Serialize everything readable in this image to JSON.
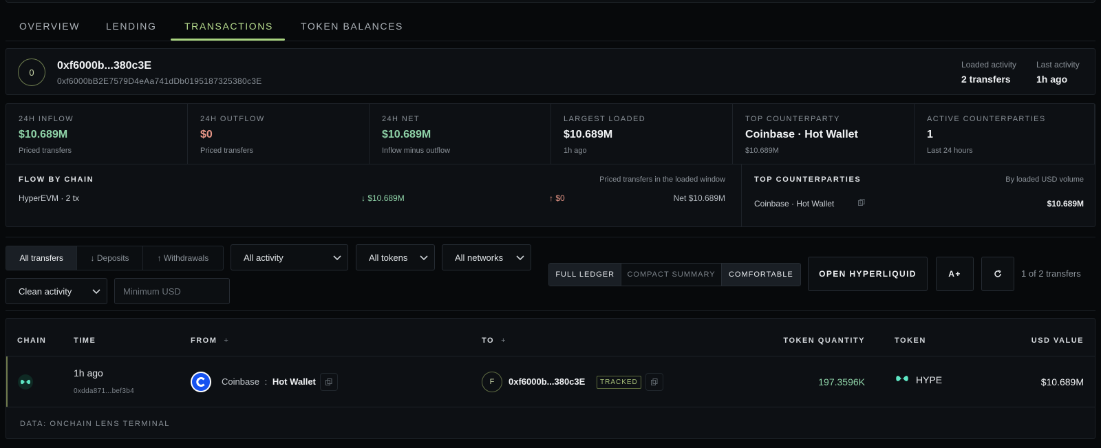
{
  "tabs": [
    {
      "label": "OVERVIEW"
    },
    {
      "label": "LENDING"
    },
    {
      "label": "TRANSACTIONS"
    },
    {
      "label": "TOKEN BALANCES"
    }
  ],
  "wallet": {
    "avatar_letter": "0",
    "short": "0xf6000b...380c3E",
    "full": "0xf6000bB2E7579D4eAa741dDb0195187325380c3E",
    "loaded_activity_label": "Loaded activity",
    "loaded_activity_value": "2 transfers",
    "last_activity_label": "Last activity",
    "last_activity_value": "1h ago"
  },
  "stats": [
    {
      "label": "24H INFLOW",
      "value": "$10.689M",
      "sub": "Priced transfers"
    },
    {
      "label": "24H OUTFLOW",
      "value": "$0",
      "sub": "Priced transfers"
    },
    {
      "label": "24H NET",
      "value": "$10.689M",
      "sub": "Inflow minus outflow"
    },
    {
      "label": "LARGEST LOADED",
      "value": "$10.689M",
      "sub": "1h ago"
    },
    {
      "label": "TOP COUNTERPARTY",
      "value": "Coinbase · Hot Wallet",
      "sub": "$10.689M"
    },
    {
      "label": "ACTIVE COUNTERPARTIES",
      "value": "1",
      "sub": "Last 24 hours"
    }
  ],
  "flow": {
    "title": "FLOW BY CHAIN",
    "note": "Priced transfers in the loaded window",
    "chain": "HyperEVM · 2 tx",
    "inflow": "↓ $10.689M",
    "outflow": "↑ $0",
    "net": "Net $10.689M"
  },
  "counterparties": {
    "title": "TOP COUNTERPARTIES",
    "note": "By loaded USD volume",
    "name": "Coinbase · Hot Wallet",
    "value": "$10.689M"
  },
  "filters": {
    "segments": [
      "All transfers",
      "↓ Deposits",
      "↑ Withdrawals"
    ],
    "activity": "All activity",
    "tokens": "All tokens",
    "networks": "All networks",
    "clean": "Clean activity",
    "min_usd_placeholder": "Minimum USD"
  },
  "view": {
    "options": [
      "FULL LEDGER",
      "COMPACT SUMMARY",
      "COMFORTABLE"
    ],
    "open_button": "OPEN HYPERLIQUID",
    "font_button": "A+",
    "refresh_icon": "refresh-icon",
    "count": "1 of 2 transfers"
  },
  "table": {
    "headers": {
      "chain": "CHAIN",
      "time": "TIME",
      "from": "FROM",
      "to": "TO",
      "quantity": "TOKEN QUANTITY",
      "token": "TOKEN",
      "usd": "USD VALUE"
    },
    "plus": "+",
    "row": {
      "time": "1h ago",
      "hash": "0xdda871...bef3b4",
      "from_entity": "Coinbase",
      "from_sep": ":",
      "from_label": "Hot Wallet",
      "to_letter": "F",
      "to_address": "0xf6000b...380c3E",
      "to_badge": "TRACKED",
      "quantity": "197.3596K",
      "token": "HYPE",
      "usd": "$10.689M"
    },
    "footer": "DATA: ONCHAIN LENS TERMINAL"
  },
  "colors": {
    "accent_green": "#a9d47f",
    "inflow": "#8fd3a8",
    "outflow": "#e59586",
    "hype": "#5ee6c4"
  }
}
